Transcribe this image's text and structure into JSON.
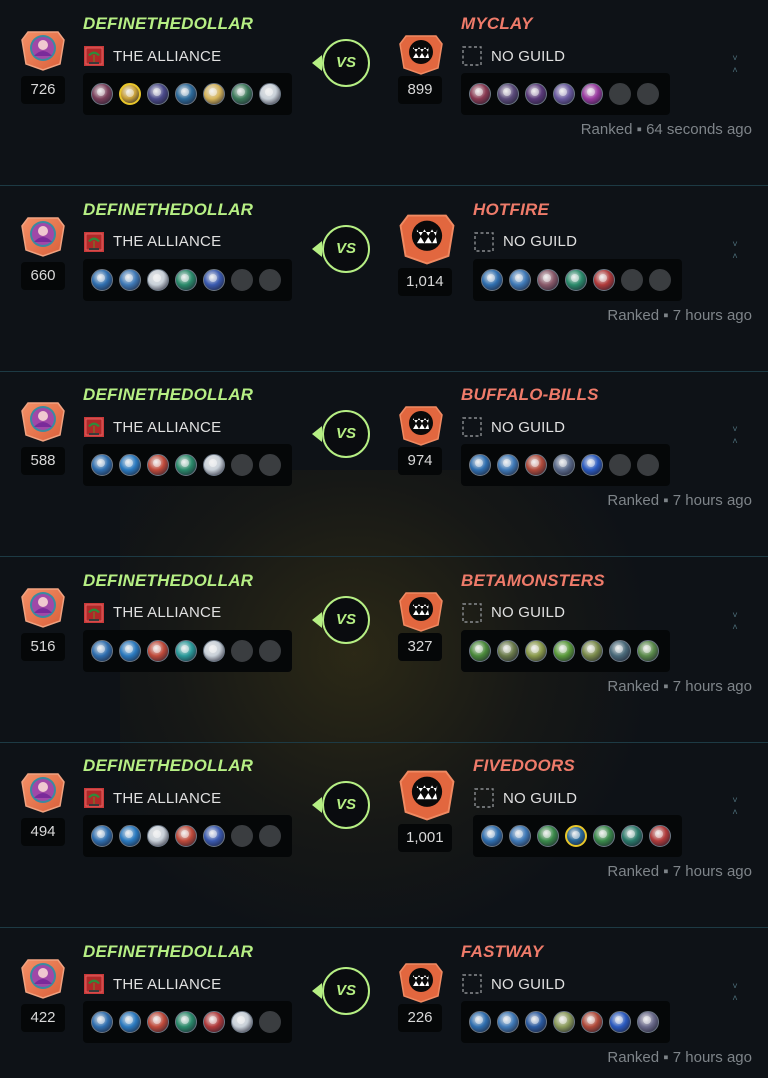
{
  "battles": [
    {
      "player": {
        "name": "DEFINETHEDOLLAR",
        "rating": "726",
        "guild": "THE ALLIANCE"
      },
      "opponent": {
        "name": "MYCLAY",
        "rating": "899",
        "guild": "NO GUILD"
      },
      "vs_label": "VS",
      "ranked_label": "Ranked",
      "separator": "▪",
      "time": "64 seconds ago",
      "player_team": [
        "#7a3f5a",
        "#c9a13a",
        "#4a4a8a",
        "#2c6a9a",
        "#d6b45a",
        "#3c7a5a",
        "#c8d0d8"
      ],
      "player_team_gold": [
        false,
        true,
        false,
        false,
        false,
        false,
        false
      ],
      "opponent_team": [
        "#8a3a52",
        "#5a4a7a",
        "#5a3a7a",
        "#6a5aa0",
        "#9a3aa0",
        "",
        ""
      ]
    },
    {
      "player": {
        "name": "DEFINETHEDOLLAR",
        "rating": "660",
        "guild": "THE ALLIANCE"
      },
      "opponent": {
        "name": "HOTFIRE",
        "rating": "1,014",
        "guild": "NO GUILD"
      },
      "vs_label": "VS",
      "ranked_label": "Ranked",
      "separator": "▪",
      "time": "7 hours ago",
      "player_team": [
        "#2f6fb0",
        "#3f7ab8",
        "#c8d0d8",
        "#2a8a6a",
        "#3a5ab0",
        "",
        ""
      ],
      "player_team_gold": [
        false,
        false,
        false,
        false,
        false,
        false,
        false
      ],
      "opponent_team": [
        "#2f6fb0",
        "#3f7ab8",
        "#8a5a6a",
        "#2a8a6a",
        "#b03a3a",
        "",
        ""
      ]
    },
    {
      "player": {
        "name": "DEFINETHEDOLLAR",
        "rating": "588",
        "guild": "THE ALLIANCE"
      },
      "opponent": {
        "name": "BUFFALO-BILLS",
        "rating": "974",
        "guild": "NO GUILD"
      },
      "vs_label": "VS",
      "ranked_label": "Ranked",
      "separator": "▪",
      "time": "7 hours ago",
      "player_team": [
        "#2f6fb0",
        "#2a7ac0",
        "#c04a3a",
        "#2a8a6a",
        "#c8d0d8",
        "",
        ""
      ],
      "player_team_gold": [
        false,
        false,
        false,
        false,
        false,
        false,
        false
      ],
      "opponent_team": [
        "#2f6fb0",
        "#3f7ab8",
        "#b04a3a",
        "#5a6a8a",
        "#2a5ac0",
        "",
        ""
      ]
    },
    {
      "player": {
        "name": "DEFINETHEDOLLAR",
        "rating": "516",
        "guild": "THE ALLIANCE"
      },
      "opponent": {
        "name": "BETAMONSTERS",
        "rating": "327",
        "guild": "NO GUILD"
      },
      "vs_label": "VS",
      "ranked_label": "Ranked",
      "separator": "▪",
      "time": "7 hours ago",
      "player_team": [
        "#2f6fb0",
        "#2a7ac0",
        "#c04a3a",
        "#2a9a9a",
        "#c8d0d8",
        "",
        ""
      ],
      "player_team_gold": [
        false,
        false,
        false,
        false,
        false,
        false,
        false
      ],
      "opponent_team": [
        "#4a8a3a",
        "#6a7a4a",
        "#8a9a4a",
        "#5a9a3a",
        "#7a8a4a",
        "#4a6a7a",
        "#5a8a4a"
      ]
    },
    {
      "player": {
        "name": "DEFINETHEDOLLAR",
        "rating": "494",
        "guild": "THE ALLIANCE"
      },
      "opponent": {
        "name": "FIVEDOORS",
        "rating": "1,001",
        "guild": "NO GUILD"
      },
      "vs_label": "VS",
      "ranked_label": "Ranked",
      "separator": "▪",
      "time": "7 hours ago",
      "player_team": [
        "#2f6fb0",
        "#2a7ac0",
        "#c8d0d8",
        "#c04a3a",
        "#3a5ab0",
        "",
        ""
      ],
      "player_team_gold": [
        false,
        false,
        false,
        false,
        false,
        false,
        false
      ],
      "opponent_team": [
        "#2f6fb0",
        "#3f7ab8",
        "#3a8a4a",
        "#2a6a9a",
        "#3a8a4a",
        "#2a7a6a",
        "#b03a3a"
      ],
      "opponent_team_gold": [
        false,
        false,
        false,
        true,
        false,
        false,
        false
      ]
    },
    {
      "player": {
        "name": "DEFINETHEDOLLAR",
        "rating": "422",
        "guild": "THE ALLIANCE"
      },
      "opponent": {
        "name": "FASTWAY",
        "rating": "226",
        "guild": "NO GUILD"
      },
      "vs_label": "VS",
      "ranked_label": "Ranked",
      "separator": "▪",
      "time": "7 hours ago",
      "player_team": [
        "#2f6fb0",
        "#2a7ac0",
        "#c04a3a",
        "#2a8a6a",
        "#b03a3a",
        "#c8d0d8",
        ""
      ],
      "player_team_gold": [
        false,
        false,
        false,
        false,
        false,
        false,
        false
      ],
      "opponent_team": [
        "#2f6fb0",
        "#3f7ab8",
        "#2a5aa0",
        "#8a9a5a",
        "#b04a3a",
        "#2a5ac0",
        "#6a6a8a"
      ]
    }
  ],
  "colors": {
    "winner": "#b6ef84",
    "loser": "#ef7b6a",
    "background": "#0e1217",
    "divider": "#1d3a44"
  }
}
